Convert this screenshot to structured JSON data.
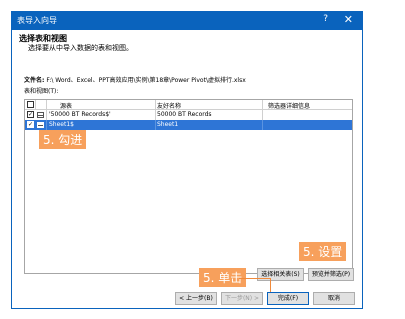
{
  "window": {
    "title": "表导入向导",
    "help": "?",
    "close": "✕"
  },
  "section": {
    "title": "选择表和视图",
    "description": "选择要从中导入数据的表和视图。"
  },
  "file": {
    "label": "文件名:",
    "path": "F:\\ Word、Excel、PPT高效应用\\实例\\第18章\\Power Pivot\\虚拟排行.xlsx"
  },
  "tables_label": "表和视图(T):",
  "grid": {
    "headers": {
      "source": "源表",
      "friendly": "友好名称",
      "filter": "筛选器详细信息"
    },
    "rows": [
      {
        "source": "'50000 BT Records$'",
        "friendly": "50000 BT Records",
        "filter": "",
        "checked": true,
        "selected": false
      },
      {
        "source": "Sheet1$",
        "friendly": "Sheet1",
        "filter": "",
        "checked": true,
        "selected": true
      }
    ]
  },
  "annotations": {
    "check": "5. 勾进",
    "settings": "5. 设置",
    "click": "5. 单击"
  },
  "buttons": {
    "select_related": "选择相关表(S)",
    "preview_filter": "预览并筛选(P)",
    "back": "< 上一步(B)",
    "next": "下一步(N) >",
    "finish": "完成(F)",
    "cancel": "取消"
  },
  "colors": {
    "accent": "#0a63bd",
    "selection": "#2e75d6",
    "annotation": "#f7a05c"
  }
}
